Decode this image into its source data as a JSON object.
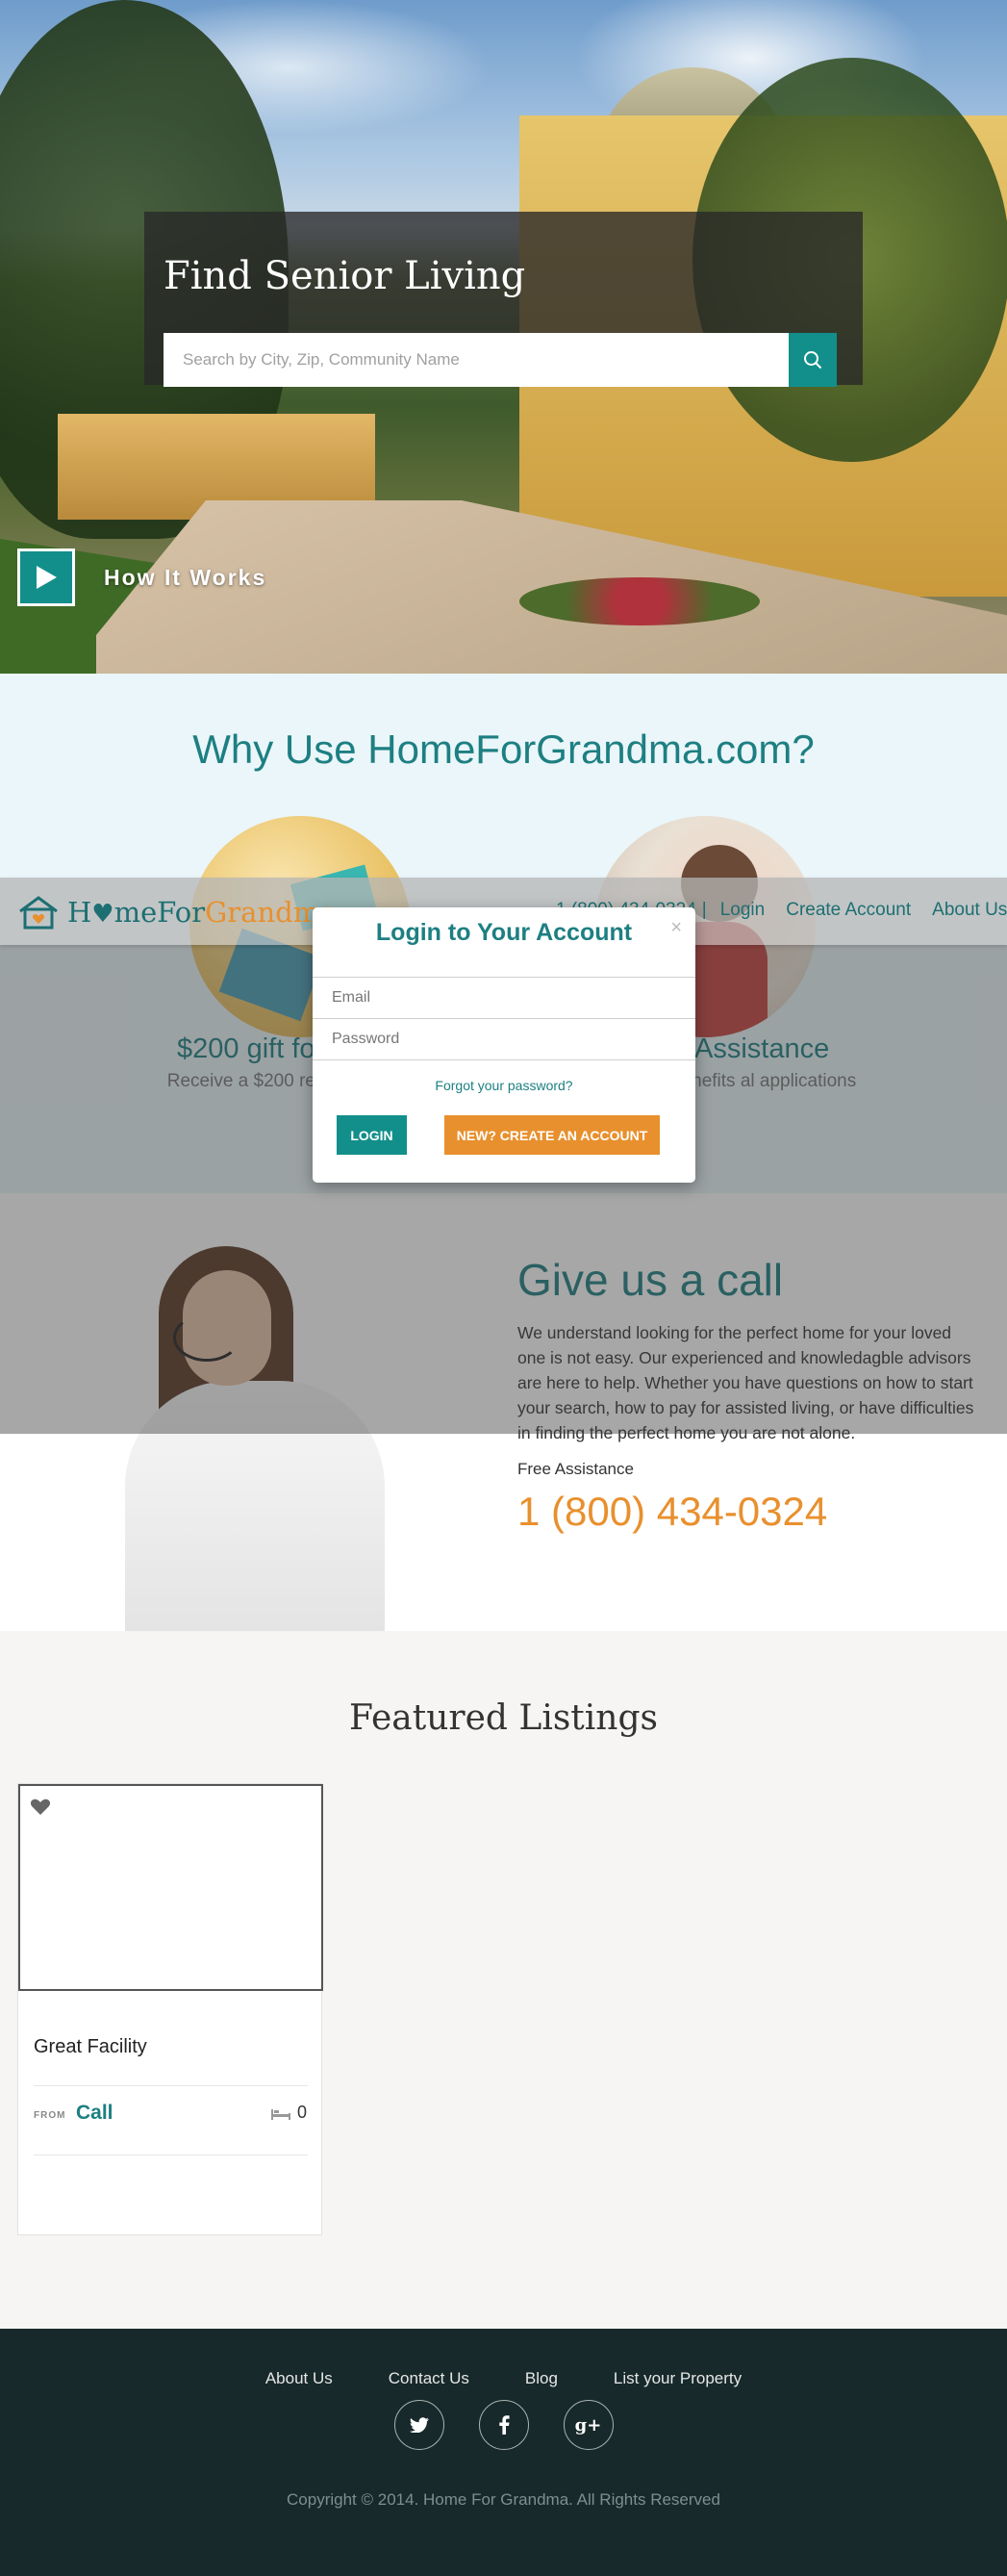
{
  "hero": {
    "search_title": "Find Senior Living",
    "search_placeholder": "Search by City, Zip, Community Name",
    "how_it_works": "How It Works"
  },
  "why": {
    "title": "Why Use HomeForGrandma.com?",
    "items": [
      {
        "title": "$200 gift fo",
        "desc": "Receive a $200 re move into a c"
      },
      {
        "title": "Assistance",
        "desc": "n Veterans Benefits al applications"
      }
    ]
  },
  "navbar": {
    "logo_part1": "H",
    "logo_part2": "meFor",
    "logo_part3": "Grandma",
    "phone": "1 (800) 434-0324",
    "links": [
      "Login",
      "Create Account",
      "About Us"
    ]
  },
  "modal": {
    "title": "Login to Your Account",
    "close": "×",
    "email_placeholder": "Email",
    "password_placeholder": "Password",
    "forgot": "Forgot your password?",
    "login_button": "LOGIN",
    "create_button": "NEW? CREATE AN ACCOUNT"
  },
  "call": {
    "title": "Give us a call",
    "desc": "We understand looking for the perfect home for your loved one is not easy. Our experienced and knowledagble advisors are here to help. Whether you have questions on how to start your search, how to pay for assisted living, or have difficulties in finding the perfect home you are not alone.",
    "sub": "Free Assistance",
    "phone": "1 (800) 434-0324"
  },
  "featured": {
    "title": "Featured Listings",
    "listing": {
      "name": "Great Facility",
      "from": "FROM",
      "price": "Call",
      "beds": "0"
    }
  },
  "footer": {
    "links": [
      "About Us",
      "Contact Us",
      "Blog",
      "List your Property"
    ],
    "socials": [
      "twitter-icon",
      "facebook-icon",
      "google-plus-icon"
    ],
    "copyright": "Copyright © 2014. Home For Grandma. All Rights Reserved"
  },
  "colors": {
    "teal": "#128f8b",
    "teal_text": "#1d7f82",
    "orange": "#e8902e",
    "footer_bg": "#17292a"
  }
}
